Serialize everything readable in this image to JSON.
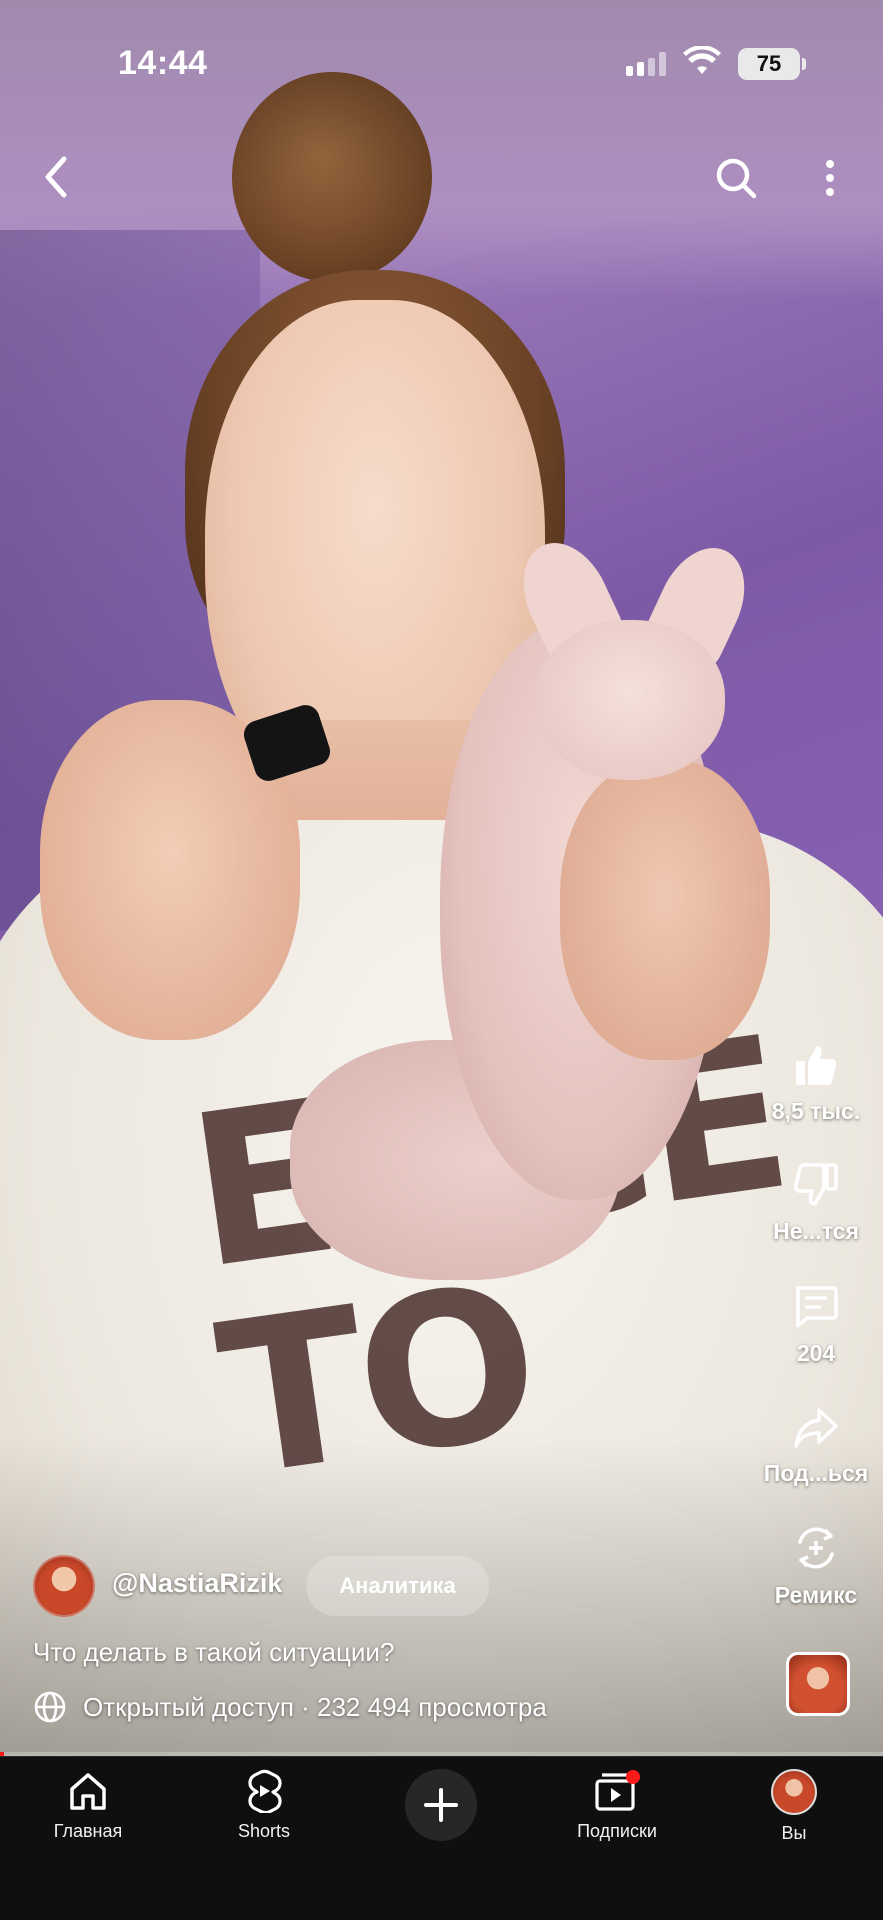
{
  "status_bar": {
    "time": "14:44",
    "battery": "75"
  },
  "video": {
    "sweater_print": "ENCE TO",
    "progress_fraction": 0.004
  },
  "actions": {
    "like_count": "8,5 тыс.",
    "dislike_label": "Не...тся",
    "comments_count": "204",
    "share_label": "Под...ься",
    "remix_label": "Ремикс"
  },
  "channel": {
    "name": "@NastiaRizik",
    "analytics_button": "Аналитика"
  },
  "caption": "Что делать в такой ситуации?",
  "meta": {
    "visibility_and_views": "Открытый доступ · 232 494 просмотра"
  },
  "nav": {
    "home": "Главная",
    "shorts": "Shorts",
    "subscriptions": "Подписки",
    "you": "Вы"
  },
  "colors": {
    "accent_red": "#ff1a1a",
    "nav_bg": "#0f0f0f"
  }
}
